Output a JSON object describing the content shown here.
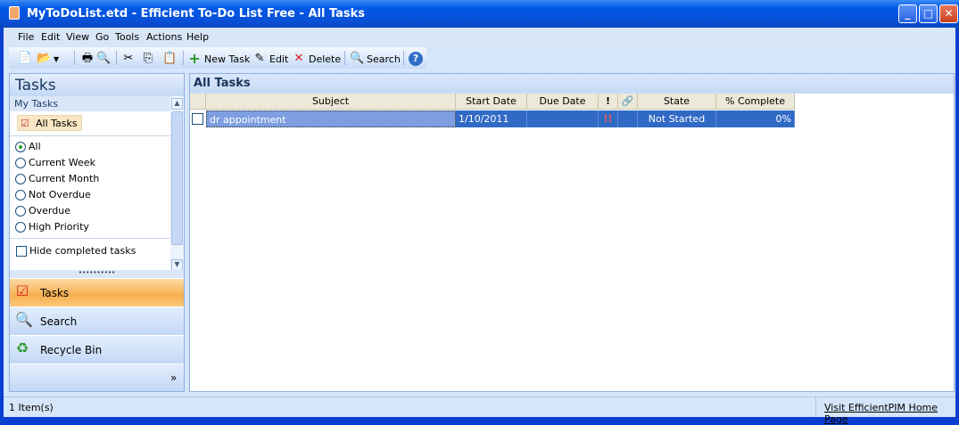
{
  "window": {
    "title": "MyToDoList.etd - Efficient To-Do List Free - All Tasks",
    "minimize": "_",
    "maximize": "□",
    "close": "✕"
  },
  "menu": [
    "File",
    "Edit",
    "View",
    "Go",
    "Tools",
    "Actions",
    "Help"
  ],
  "toolbar": {
    "new_task": "New Task",
    "edit": "Edit",
    "delete": "Delete",
    "search": "Search"
  },
  "left": {
    "title": "Tasks",
    "group": "My Tasks",
    "all_tasks": "All Tasks",
    "filters": [
      {
        "label": "All",
        "selected": true
      },
      {
        "label": "Current Week",
        "selected": false
      },
      {
        "label": "Current Month",
        "selected": false
      },
      {
        "label": "Not Overdue",
        "selected": false
      },
      {
        "label": "Overdue",
        "selected": false
      },
      {
        "label": "High Priority",
        "selected": false
      }
    ],
    "hide_completed": "Hide completed tasks",
    "nav": [
      {
        "label": "Tasks",
        "active": true
      },
      {
        "label": "Search",
        "active": false
      },
      {
        "label": "Recycle Bin",
        "active": false
      }
    ]
  },
  "main": {
    "title": "All Tasks",
    "columns": [
      "Subject",
      "Start Date",
      "Due Date",
      "!",
      "🔗",
      "State",
      "% Complete"
    ],
    "rows": [
      {
        "subject": "dr appointment",
        "start": "1/10/2011",
        "due": "",
        "priority": "!!",
        "state": "Not Started",
        "complete": "0%"
      }
    ]
  },
  "status": {
    "count": "1 Item(s)",
    "link": "Visit EfficientPIM Home Page"
  }
}
